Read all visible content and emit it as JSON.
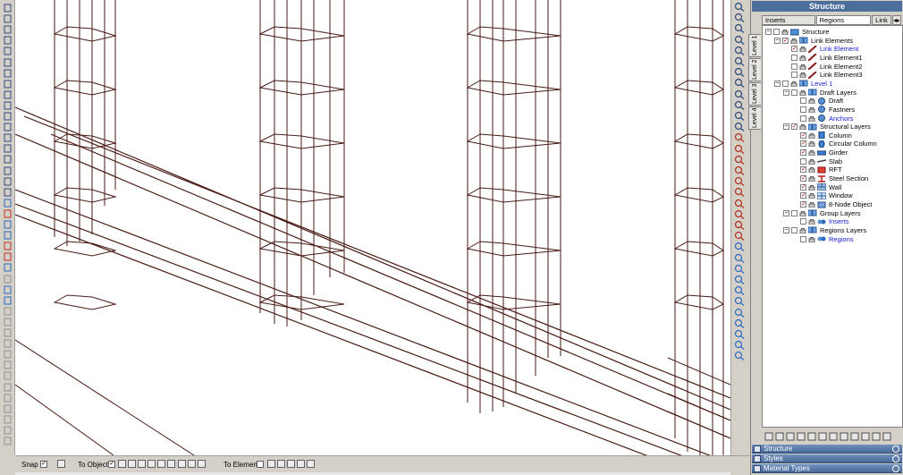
{
  "panel": {
    "title": "Structure",
    "tabs": [
      "Inserts",
      "Regions",
      "Link"
    ],
    "level_tabs": [
      "Level 1",
      "Level 2",
      "Level 3",
      "Level 4"
    ],
    "tree": [
      {
        "label": "Structure",
        "blue": false
      },
      {
        "label": "Link Elements",
        "blue": false
      },
      {
        "label": "Link Element",
        "blue": true
      },
      {
        "label": "Link Element1",
        "blue": false
      },
      {
        "label": "Link Element2",
        "blue": false
      },
      {
        "label": "Link Element3",
        "blue": false
      },
      {
        "label": "Level 1",
        "blue": true
      },
      {
        "label": "Draft Layers",
        "blue": false
      },
      {
        "label": "Draft",
        "blue": false
      },
      {
        "label": "Fastners",
        "blue": false
      },
      {
        "label": "Anchors",
        "blue": true
      },
      {
        "label": "Structural Layers",
        "blue": false
      },
      {
        "label": "Column",
        "blue": false
      },
      {
        "label": "Circular Column",
        "blue": false
      },
      {
        "label": "Girder",
        "blue": false
      },
      {
        "label": "Slab",
        "blue": false
      },
      {
        "label": "RFT",
        "blue": false
      },
      {
        "label": "Steel Section",
        "blue": false
      },
      {
        "label": "Wall",
        "blue": false
      },
      {
        "label": "Window",
        "blue": false
      },
      {
        "label": "8-Node Object",
        "blue": false
      },
      {
        "label": "Group Layers",
        "blue": false
      },
      {
        "label": "Inserts",
        "blue": true
      },
      {
        "label": "Regions Layers",
        "blue": false
      },
      {
        "label": "Regions",
        "blue": true
      }
    ],
    "dock_bars": [
      "Structure",
      "Styles",
      "Material Types"
    ]
  },
  "statusbar": {
    "snap_label": "Snap",
    "to_object_label": "To Object",
    "to_element_label": "To Element"
  },
  "colors": {
    "wire": "#4a1a14",
    "panel_title": "#4c6e9c",
    "tree_blue": "#1a1ad4"
  }
}
